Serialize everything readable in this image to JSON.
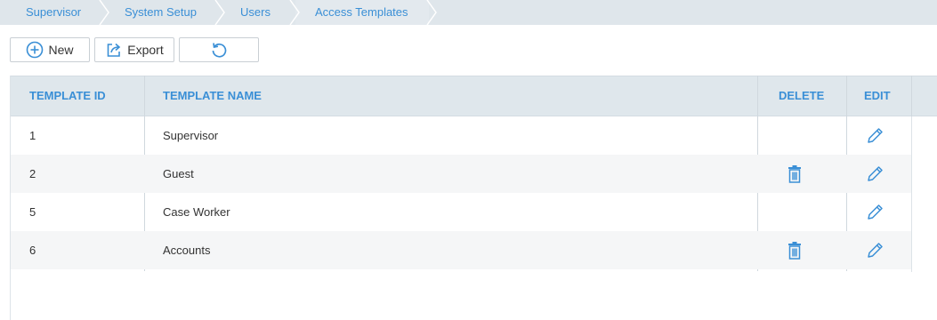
{
  "breadcrumb": [
    "Supervisor",
    "System Setup",
    "Users",
    "Access Templates"
  ],
  "toolbar": {
    "new_label": "New",
    "export_label": "Export"
  },
  "columns": {
    "id": "TEMPLATE ID",
    "name": "TEMPLATE NAME",
    "delete": "DELETE",
    "edit": "EDIT"
  },
  "rows": [
    {
      "id": "1",
      "name": "Supervisor",
      "deletable": false
    },
    {
      "id": "2",
      "name": "Guest",
      "deletable": true
    },
    {
      "id": "5",
      "name": "Case Worker",
      "deletable": false
    },
    {
      "id": "6",
      "name": "Accounts",
      "deletable": true
    }
  ],
  "colors": {
    "accent": "#3a8fd6",
    "header_bg": "#dfe7ec",
    "alt_row": "#f5f6f7"
  }
}
